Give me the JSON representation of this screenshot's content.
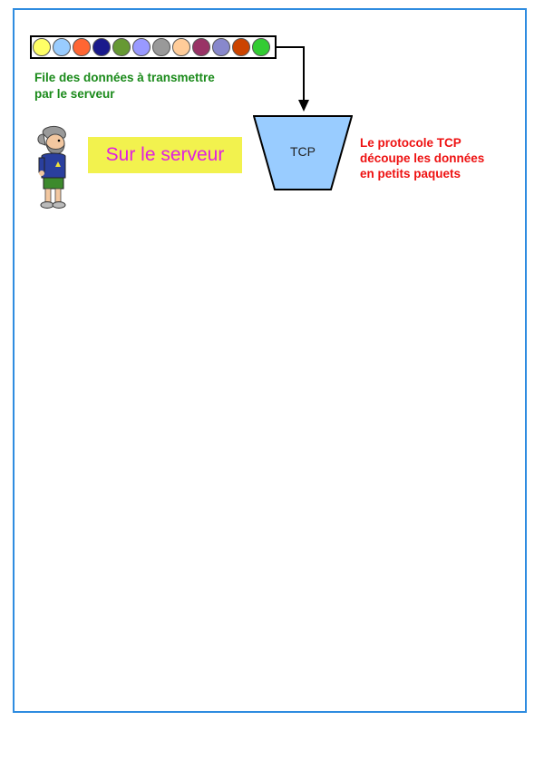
{
  "queue": {
    "label_line1": "File des données à transmettre",
    "label_line2": "par le serveur",
    "packets": [
      {
        "color": "#ffff66"
      },
      {
        "color": "#99ccff"
      },
      {
        "color": "#ff6633"
      },
      {
        "color": "#1a1a8c"
      },
      {
        "color": "#669933"
      },
      {
        "color": "#9999ff"
      },
      {
        "color": "#999999"
      },
      {
        "color": "#ffcc99"
      },
      {
        "color": "#993366"
      },
      {
        "color": "#8888cc"
      },
      {
        "color": "#cc4400"
      },
      {
        "color": "#33cc33"
      }
    ]
  },
  "server_badge": {
    "text": "Sur le serveur",
    "background": "#f2f24e",
    "text_color": "#e01fe0"
  },
  "tcp": {
    "label": "TCP",
    "fill": "#99ccff",
    "note_line1": "Le protocole TCP",
    "note_line2": "découpe les données",
    "note_line3": "en petits paquets",
    "note_color": "#ee1111"
  },
  "person": {
    "icon": "bearded-man-icon"
  },
  "colors": {
    "frame_border": "#2f8ce0",
    "queue_label": "#1a8a1a"
  }
}
